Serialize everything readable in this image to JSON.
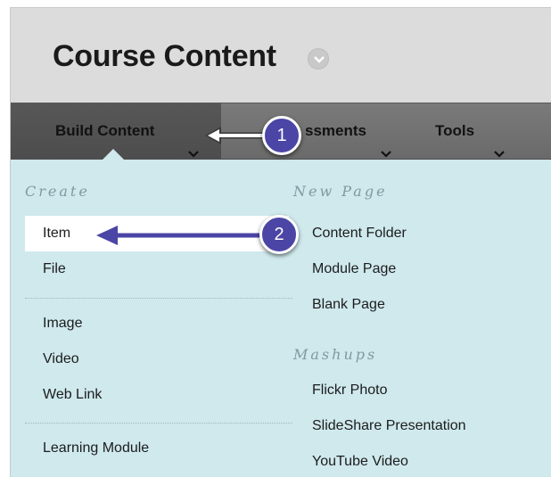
{
  "page": {
    "title": "Course Content"
  },
  "menu_bar": {
    "build_content": "Build Content",
    "assessments_partial": "ssments",
    "tools": "Tools"
  },
  "dropdown": {
    "create_heading": "Create",
    "create_items": [
      "Item",
      "File",
      "Image",
      "Video",
      "Web Link",
      "Learning Module"
    ],
    "new_page_heading": "New Page",
    "new_page_items": [
      "Content Folder",
      "Module Page",
      "Blank Page"
    ],
    "mashups_heading": "Mashups",
    "mashups_items": [
      "Flickr Photo",
      "SlideShare Presentation",
      "YouTube Video"
    ]
  },
  "callouts": [
    {
      "number": "1",
      "color": "#4b45a6"
    },
    {
      "number": "2",
      "color": "#4b45a6"
    }
  ],
  "colors": {
    "title_bar": "#dcdcdc",
    "menu_bar": "#6f6f6f",
    "dropdown_bg": "#cfe9ed",
    "callout": "#4b45a6"
  }
}
